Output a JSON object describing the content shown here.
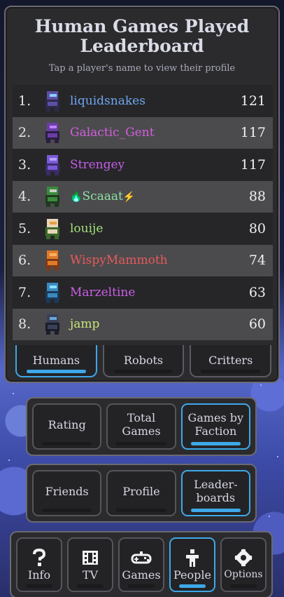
{
  "leaderboard": {
    "title_line1": "Human Games Played",
    "title_line2": "Leaderboard",
    "subtitle": "Tap a player's name to view their profile",
    "players": [
      {
        "rank": "1.",
        "name": "liquidsnakes",
        "count": "121",
        "color": "#6fa6ee"
      },
      {
        "rank": "2.",
        "name": "Galactic_Gent",
        "count": "117",
        "color": "#d45ee0"
      },
      {
        "rank": "3.",
        "name": "Strengey",
        "count": "117",
        "color": "#c65ee8"
      },
      {
        "rank": "4.",
        "name": "Scaaat",
        "count": "88",
        "color": "#8fe0a6",
        "prefix_icon": "flame-icon",
        "suffix_icon": "lightning-icon"
      },
      {
        "rank": "5.",
        "name": "louije",
        "count": "80",
        "color": "#a6e27a"
      },
      {
        "rank": "6.",
        "name": "WispyMammoth",
        "count": "74",
        "color": "#e8595c"
      },
      {
        "rank": "7.",
        "name": "Marzeltine",
        "count": "63",
        "color": "#cc5ee6"
      },
      {
        "rank": "8.",
        "name": "jamp",
        "count": "60",
        "color": "#c8e67a"
      }
    ],
    "tabs": [
      {
        "label": "Humans",
        "active": true
      },
      {
        "label": "Robots",
        "active": false
      },
      {
        "label": "Critters",
        "active": false
      }
    ]
  },
  "sort_options": [
    {
      "label": "Rating",
      "active": false
    },
    {
      "label": "Total\nGames",
      "active": false
    },
    {
      "label": "Games by\nFaction",
      "active": true
    }
  ],
  "people_options": [
    {
      "label": "Friends",
      "active": false
    },
    {
      "label": "Profile",
      "active": false
    },
    {
      "label": "Leader-\nboards",
      "active": true
    }
  ],
  "nav": [
    {
      "label": "Info",
      "icon": "question-icon",
      "active": false
    },
    {
      "label": "TV",
      "icon": "film-icon",
      "active": false
    },
    {
      "label": "Games",
      "icon": "gamepad-icon",
      "active": false
    },
    {
      "label": "People",
      "icon": "person-icon",
      "active": true
    },
    {
      "label": "Options",
      "icon": "gear-icon",
      "active": false
    }
  ],
  "colors": {
    "accent": "#3ea8e8",
    "panel": "#2b2b2e",
    "row_alt": "#4b4b4d"
  }
}
